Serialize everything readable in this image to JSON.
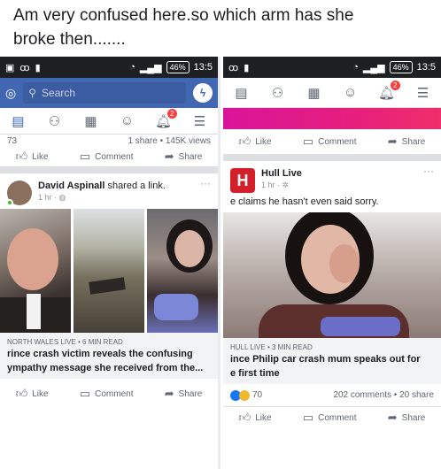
{
  "caption": {
    "line1": "Am very confused here.so which arm has she",
    "line2": "broke then......."
  },
  "left": {
    "status": {
      "time": "13:5",
      "battery": "46%"
    },
    "search_placeholder": "Search",
    "previous_post": {
      "count_fragment": "73",
      "stats": "1 share • 145K views"
    },
    "actions_top": {
      "like": "Like",
      "comment": "Comment",
      "share": "Share"
    },
    "post": {
      "name": "David Aspinall",
      "suffix": " shared a link.",
      "time": "1 hr · ◍",
      "link_source": "NORTH WALES LIVE • 6 MIN READ",
      "link_title_1": "rince crash victim reveals the confusing",
      "link_title_2": "ympathy message she received from the..."
    },
    "actions_bottom": {
      "like": "Like",
      "comment": "Comment",
      "share": "Share"
    },
    "notification_count": "2"
  },
  "right": {
    "status": {
      "time": "13:5",
      "battery": "46%"
    },
    "notification_count": "2",
    "actions_top": {
      "like": "Like",
      "comment": "Comment",
      "share": "Share"
    },
    "post": {
      "name": "Hull Live",
      "time": "1 hr · ✲",
      "text": "e claims he hasn't even said sorry.",
      "link_source": "HULL LIVE • 3 MIN READ",
      "link_title_1": "ince Philip car crash mum speaks out for",
      "link_title_2": "e first time"
    },
    "reactions": {
      "count": "70",
      "stats": "202 comments • 20 share"
    },
    "actions_bottom": {
      "like": "Like",
      "comment": "Comment",
      "share": "Share"
    }
  },
  "colors": {
    "facebook_blue": "#4267b2",
    "notification_red": "#fa3e3e"
  }
}
